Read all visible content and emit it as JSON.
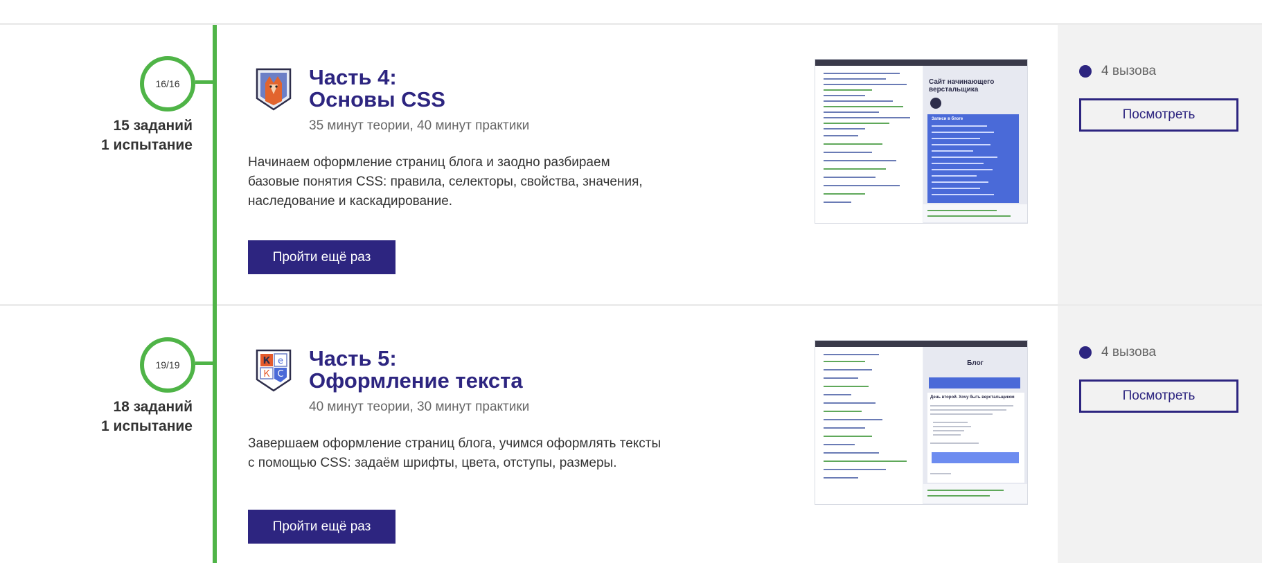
{
  "lessons": [
    {
      "progress": "16/16",
      "tasks": "15 заданий",
      "trials": "1 испытание",
      "title_line1": "Часть 4:",
      "title_line2": "Основы CSS",
      "duration": "35 минут теории, 40 минут практики",
      "description": "Начинаем оформление страниц блога и заодно разбираем базовые понятия CSS: правила, селекторы, свойства, значения, наследование и каскадирование.",
      "retake_label": "Пройти ещё раз",
      "calls": "4 вызова",
      "view_label": "Посмотреть",
      "preview": {
        "title": "Сайт начинающего верстальщика",
        "block_heading": "Записи в блоге"
      }
    },
    {
      "progress": "19/19",
      "tasks": "18 заданий",
      "trials": "1 испытание",
      "title_line1": "Часть 5:",
      "title_line2": "Оформление текста",
      "duration": "40 минут теории, 30 минут практики",
      "description": "Завершаем оформление страниц блога, учимся оформлять тексты с помощью CSS: задаём шрифты, цвета, отступы, размеры.",
      "retake_label": "Пройти ещё раз",
      "calls": "4 вызова",
      "view_label": "Посмотреть",
      "preview": {
        "title": "Блог",
        "post_title": "День второй. Хочу быть верстальщиком"
      }
    }
  ],
  "colors": {
    "accent": "#2d2580",
    "timeline": "#4fb447",
    "panel": "#f2f2f2"
  }
}
